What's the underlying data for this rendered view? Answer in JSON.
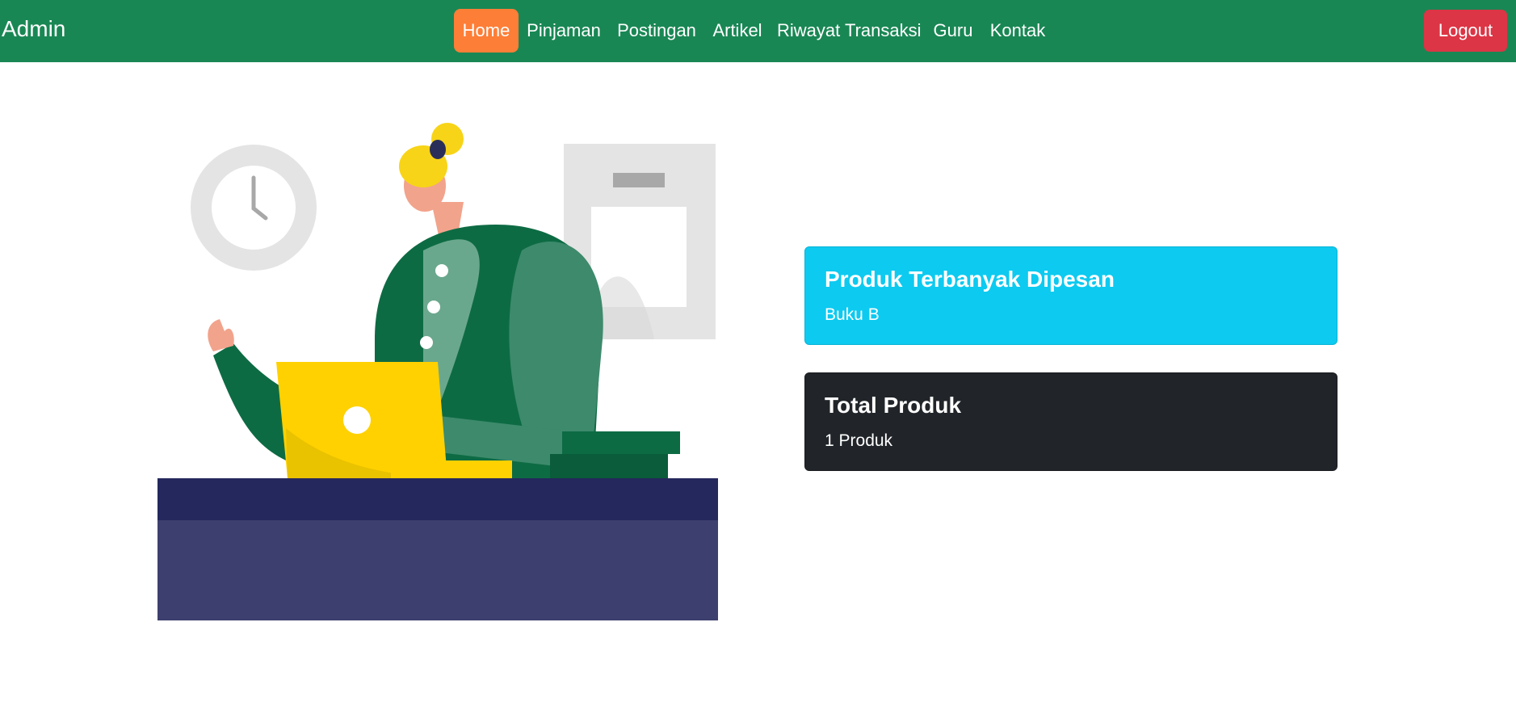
{
  "navbar": {
    "brand": "Admin",
    "links": [
      {
        "label": "Home",
        "active": true
      },
      {
        "label": "Pinjaman"
      },
      {
        "label": "Postingan"
      },
      {
        "label": "Artikel"
      },
      {
        "label": "Riwayat Transaksi"
      },
      {
        "label": "Guru"
      },
      {
        "label": "Kontak"
      }
    ],
    "logout_label": "Logout"
  },
  "cards": {
    "top_product": {
      "title": "Produk Terbanyak Dipesan",
      "value": "Buku B"
    },
    "total_product": {
      "title": "Total Produk",
      "value": "1 Produk"
    }
  },
  "colors": {
    "navbar_bg": "#198754",
    "active_link": "#fd7e37",
    "logout": "#dc3545",
    "card_info": "#0dcaf0",
    "card_dark": "#212529"
  },
  "icons": {
    "hero_illustration": "woman-working-on-laptop-illustration"
  }
}
